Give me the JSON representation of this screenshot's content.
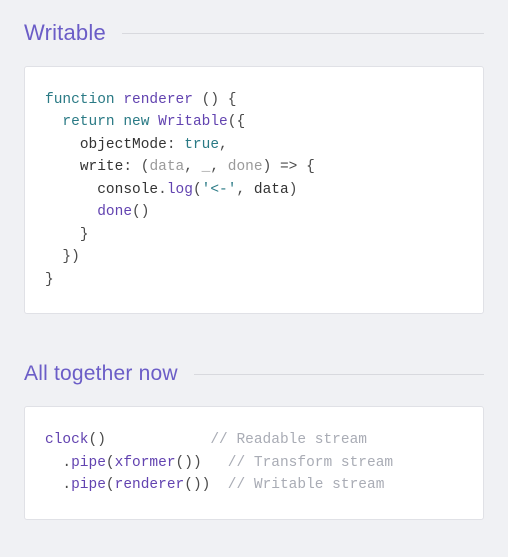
{
  "section1": {
    "heading": "Writable",
    "code": {
      "l1": {
        "kw1": "function",
        "fn": "renderer",
        "rest": " () {"
      },
      "l2": {
        "kw1": "return",
        "kw2": "new",
        "cls": "Writable",
        "rest": "({"
      },
      "l3": {
        "prop": "objectMode",
        "colon": ":",
        "val": "true",
        "comma": ","
      },
      "l4": {
        "prop": "write",
        "colon": ":",
        "open": "(",
        "p1": "data",
        "c1": ",",
        "p2": "_",
        "c2": ",",
        "p3": "done",
        "close": ")",
        "arrow": "=>",
        "brace": "{"
      },
      "l5": {
        "obj": "console",
        "dot": ".",
        "fn": "log",
        "open": "(",
        "str": "'<-'",
        "comma": ",",
        "arg": "data",
        "close": ")"
      },
      "l6": {
        "fn": "done",
        "call": "()"
      },
      "l7": {
        "brace": "}"
      },
      "l8": {
        "brace": "})"
      },
      "l9": {
        "brace": "}"
      }
    }
  },
  "section2": {
    "heading": "All together now",
    "code": {
      "l1": {
        "fn": "clock",
        "call": "()",
        "pad": "            ",
        "cmt": "// Readable stream"
      },
      "l2": {
        "dot": ".",
        "fn": "pipe",
        "open": "(",
        "inner": "xformer",
        "icall": "()",
        "close": ")",
        "pad": "   ",
        "cmt": "// Transform stream"
      },
      "l3": {
        "dot": ".",
        "fn": "pipe",
        "open": "(",
        "inner": "renderer",
        "icall": "()",
        "close": ")",
        "pad": "  ",
        "cmt": "// Writable stream"
      }
    }
  }
}
